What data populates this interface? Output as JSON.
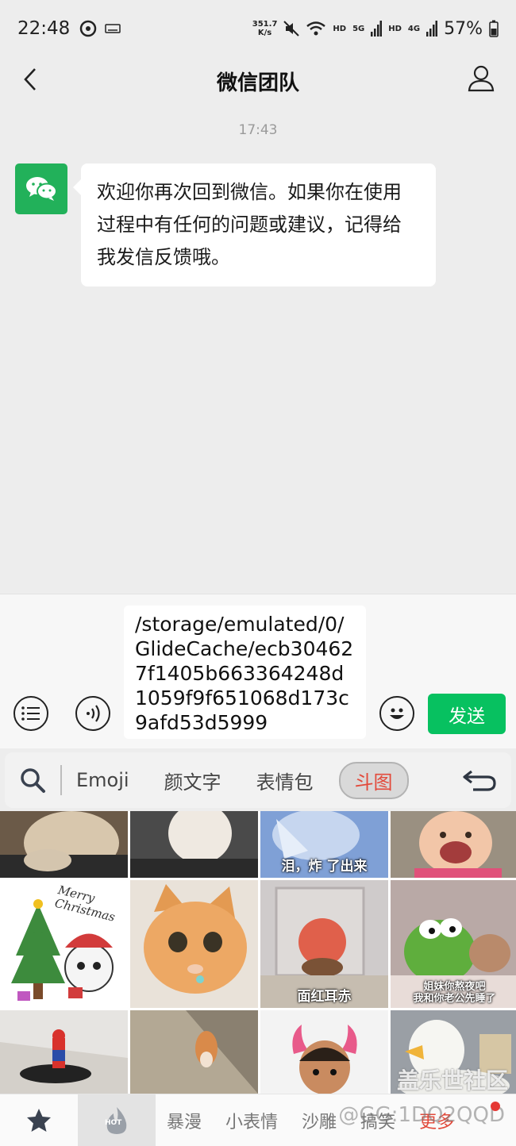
{
  "status_bar": {
    "time": "22:48",
    "net_speed_value": "351.7",
    "net_speed_unit": "K/s",
    "hd1": "HD",
    "sig1": "5G",
    "hd2": "HD",
    "sig2": "4G",
    "battery": "57%"
  },
  "nav": {
    "title": "微信团队"
  },
  "chat": {
    "timestamp": "17:43",
    "message": "欢迎你再次回到微信。如果你在使用过程中有任何的问题或建议，记得给我发信反馈哦。"
  },
  "input_bar": {
    "text": "/storage/emulated/0/GlideCache/ecb304627f1405b663364248d1059f9f651068d173c9afd53d5999",
    "send_label": "发送"
  },
  "keyboard_tabs": {
    "emoji": "Emoji",
    "kaomoji": "颜文字",
    "stickers": "表情包",
    "doutu": "斗图"
  },
  "sticker_captions": {
    "s1": "泪，炸 了出来",
    "s2": "Merry Christmas",
    "s3": "面红耳赤",
    "s4_line1": "姐妹你熬夜吧",
    "s4_line2": "我和你老公先睡了"
  },
  "bottom_bar": {
    "hot_label": "HOT",
    "cats": [
      "暴漫",
      "小表情",
      "沙雕",
      "搞笑",
      "更多"
    ]
  },
  "watermarks": {
    "forum": "盖乐世社区",
    "user": "@GG:1DQ2QQD"
  },
  "colors": {
    "wechat_green": "#07c160",
    "active_tab_text": "#e24a3b"
  }
}
